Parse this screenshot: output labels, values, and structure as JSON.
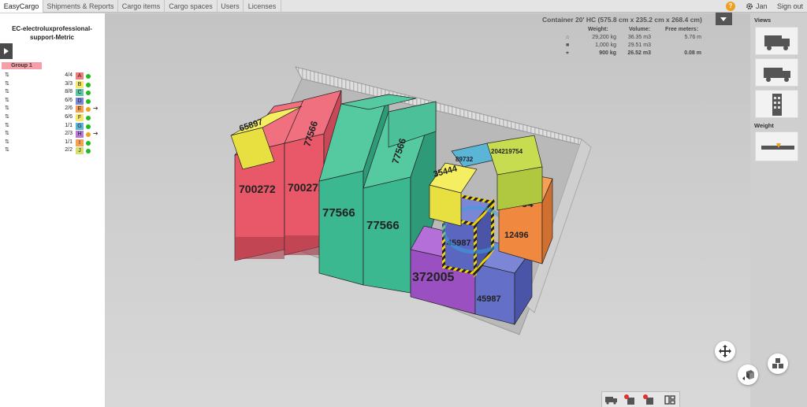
{
  "nav": {
    "tabs": [
      {
        "label": "EasyCargo",
        "active": true
      },
      {
        "label": "Shipments & Reports",
        "active": false
      },
      {
        "label": "Cargo items",
        "active": false
      },
      {
        "label": "Cargo spaces",
        "active": false
      },
      {
        "label": "Users",
        "active": false
      },
      {
        "label": "Licenses",
        "active": false
      }
    ],
    "help_label": "?",
    "user_name": "Jan",
    "signout_label": "Sign out"
  },
  "left_panel": {
    "project_name": "EC-electroluxprofessional-support-Metric",
    "group_label": "Group 1",
    "groups": [
      {
        "count": "4/4",
        "letter": "A",
        "color": "#f08080",
        "status": "green",
        "arrow": false
      },
      {
        "count": "3/3",
        "letter": "B",
        "color": "#f5e86a",
        "status": "green",
        "arrow": false
      },
      {
        "count": "8/8",
        "letter": "C",
        "color": "#5ec7a0",
        "status": "green",
        "arrow": false
      },
      {
        "count": "6/6",
        "letter": "D",
        "color": "#7b86d6",
        "status": "green",
        "arrow": false
      },
      {
        "count": "2/6",
        "letter": "E",
        "color": "#f5a055",
        "status": "orange",
        "arrow": true
      },
      {
        "count": "6/6",
        "letter": "F",
        "color": "#f5e86a",
        "status": "green",
        "arrow": false
      },
      {
        "count": "1/1",
        "letter": "G",
        "color": "#5ab5d6",
        "status": "green",
        "arrow": false
      },
      {
        "count": "2/3",
        "letter": "H",
        "color": "#b57ad6",
        "status": "orange",
        "arrow": true
      },
      {
        "count": "1/1",
        "letter": "I",
        "color": "#f5a055",
        "status": "green",
        "arrow": false
      },
      {
        "count": "2/2",
        "letter": "J",
        "color": "#d6e070",
        "status": "green",
        "arrow": false
      }
    ]
  },
  "stats": {
    "title": "Container 20' HC (575.8 cm x 235.2 cm x 268.4 cm)",
    "headers": {
      "weight": "Weight:",
      "volume": "Volume:",
      "free": "Free meters:"
    },
    "rows": [
      {
        "icon": "capacity-icon",
        "weight": "29,200 kg",
        "volume": "36.35 m3",
        "free": "5.76 m",
        "bold": false
      },
      {
        "icon": "cargo-icon",
        "weight": "1,000 kg",
        "volume": "29.51 m3",
        "free": "",
        "bold": false
      },
      {
        "icon": "loaded-icon",
        "weight": "900 kg",
        "volume": "26.52 m3",
        "free": "0.08 m",
        "bold": true
      }
    ]
  },
  "right_panel": {
    "views_label": "Views",
    "weight_label": "Weight"
  },
  "scene": {
    "box_labels": [
      "700272",
      "700272",
      "77566",
      "77566",
      "77566",
      "77566",
      "372005",
      "45987",
      "45987",
      "35444",
      "456-54",
      "12496",
      "65897",
      "204219754",
      "89732"
    ]
  },
  "colors": {
    "accent": "#f0a020",
    "status_green": "#22bb22",
    "status_orange": "#f0a020"
  }
}
